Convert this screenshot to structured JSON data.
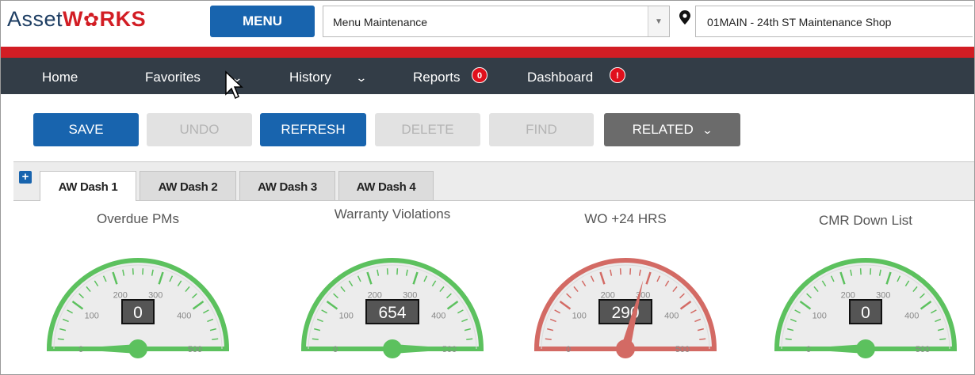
{
  "header": {
    "logo": {
      "part1": "Asset",
      "part2": "W",
      "part3": "RKS"
    },
    "menu_label": "MENU",
    "menu_select_value": "Menu Maintenance",
    "location_value": "01MAIN - 24th ST Maintenance Shop"
  },
  "nav": {
    "items": [
      {
        "label": "Home"
      },
      {
        "label": "Favorites"
      },
      {
        "label": "History"
      },
      {
        "label": "Reports",
        "badge": "0"
      },
      {
        "label": "Dashboard",
        "badge": "!"
      }
    ]
  },
  "toolbar": {
    "save": "SAVE",
    "undo": "UNDO",
    "refresh": "REFRESH",
    "delete": "DELETE",
    "find": "FIND",
    "related": "RELATED"
  },
  "tabs": [
    {
      "label": "AW Dash 1",
      "active": true
    },
    {
      "label": "AW Dash 2"
    },
    {
      "label": "AW Dash 3"
    },
    {
      "label": "AW Dash 4"
    }
  ],
  "gauges": [
    {
      "title": "Overdue PMs",
      "value": 0,
      "display": "0",
      "status": "ok"
    },
    {
      "title": "Warranty Violations",
      "value": 654,
      "display": "654",
      "status": "ok"
    },
    {
      "title": "WO +24 HRS",
      "value": 290,
      "display": "290",
      "status": "alert"
    },
    {
      "title": "CMR Down List",
      "value": 0,
      "display": "0",
      "status": "ok"
    }
  ],
  "gauge_scale": {
    "min": 0,
    "max": 500,
    "labels": [
      "0",
      "100",
      "200",
      "300",
      "400",
      "500"
    ]
  },
  "colors": {
    "brand_blue": "#1864ae",
    "brand_red": "#d21d24",
    "nav_bg": "#333d47",
    "gauge_ok": "#5cc15e",
    "gauge_alert": "#d36a64"
  },
  "icons": {
    "location": "map-pin-icon",
    "add_tab": "plus-icon",
    "dropdown": "chevron-down-icon"
  }
}
